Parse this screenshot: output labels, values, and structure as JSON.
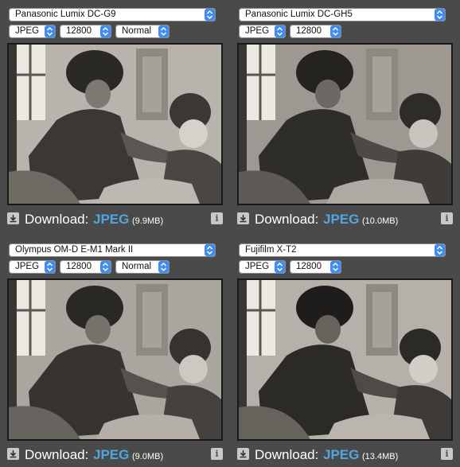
{
  "panels": [
    {
      "camera": "Panasonic Lumix DC-G9",
      "format": "JPEG",
      "iso": "12800",
      "quality": "Normal",
      "download_label": "Download:",
      "download_link": "JPEG",
      "size": "(9.9MB)"
    },
    {
      "camera": "Panasonic Lumix DC-GH5",
      "format": "JPEG",
      "iso": "12800",
      "download_label": "Download:",
      "download_link": "JPEG",
      "size": "(10.0MB)"
    },
    {
      "camera": "Olympus OM-D E-M1 Mark II",
      "format": "JPEG",
      "iso": "12800",
      "quality": "Normal",
      "download_label": "Download:",
      "download_link": "JPEG",
      "size": "(9.0MB)"
    },
    {
      "camera": "Fujifilm X-T2",
      "format": "JPEG",
      "iso": "12800",
      "download_label": "Download:",
      "download_link": "JPEG",
      "size": "(13.4MB)"
    }
  ],
  "icons": {
    "download": "download-icon",
    "info": "info-icon",
    "select_arrow": "updown-chevron-icon"
  },
  "colors": {
    "background": "#4a4a4a",
    "link": "#4fa7e0",
    "select_arrow": "#3f8df4"
  }
}
